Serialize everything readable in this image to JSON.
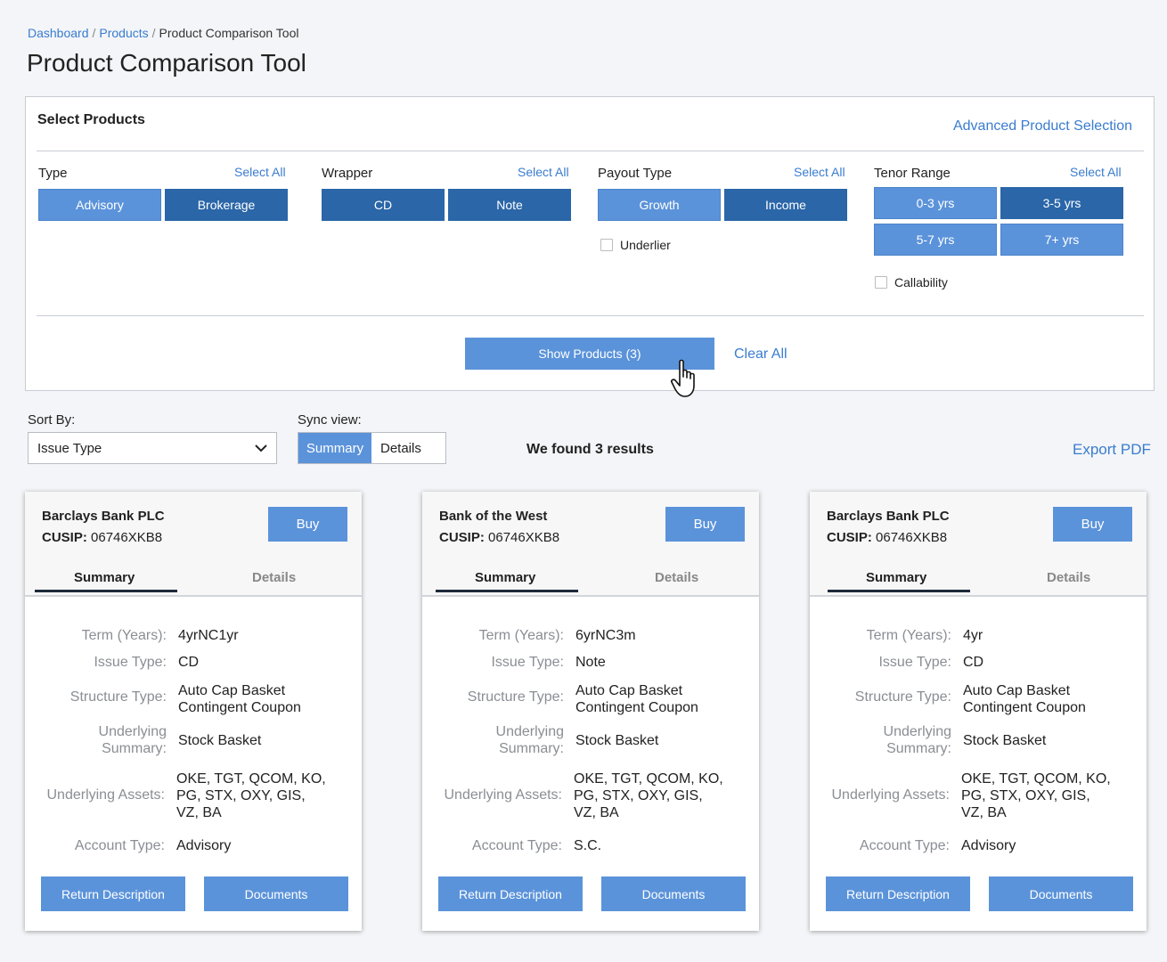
{
  "breadcrumb": {
    "items": [
      "Dashboard",
      "Products"
    ],
    "current": "Product Comparison Tool",
    "separator": "/"
  },
  "page_title": "Product Comparison Tool",
  "select_panel": {
    "title": "Select Products",
    "advanced_link": "Advanced Product Selection",
    "select_all_label": "Select All",
    "groups": {
      "type": {
        "label": "Type",
        "options": [
          "Advisory",
          "Brokerage"
        ]
      },
      "wrapper": {
        "label": "Wrapper",
        "options": [
          "CD",
          "Note"
        ]
      },
      "payout": {
        "label": "Payout Type",
        "options": [
          "Growth",
          "Income"
        ],
        "checkbox": "Underlier"
      },
      "tenor": {
        "label": "Tenor Range",
        "options": [
          "0-3 yrs",
          "3-5 yrs",
          "5-7 yrs",
          "7+ yrs"
        ],
        "checkbox": "Callability"
      }
    },
    "show_button": "Show Products (3)",
    "clear_all": "Clear All"
  },
  "controls": {
    "sort_label": "Sort By:",
    "sort_value": "Issue Type",
    "sync_label": "Sync view:",
    "sync_options": [
      "Summary",
      "Details"
    ],
    "results": "We found 3 results",
    "export": "Export PDF"
  },
  "field_labels": {
    "term": "Term (Years):",
    "issue_type": "Issue Type:",
    "structure_type": "Structure Type:",
    "underlying_summary_1": "Underlying",
    "underlying_summary_2": "Summary:",
    "underlying_assets": "Underlying Assets:",
    "account_type": "Account Type:"
  },
  "card_tabs": [
    "Summary",
    "Details"
  ],
  "card_buttons": {
    "buy": "Buy",
    "return_description": "Return Description",
    "documents": "Documents"
  },
  "cusip_label": "CUSIP:",
  "cards": [
    {
      "issuer": "Barclays Bank PLC",
      "cusip": "06746XKB8",
      "term": "4yrNC1yr",
      "issue_type": "CD",
      "structure_1": "Auto Cap Basket",
      "structure_2": "Contingent Coupon",
      "underlying_summary": "Stock Basket",
      "assets_1": "OKE, TGT, QCOM, KO,",
      "assets_2": "PG, STX, OXY, GIS,",
      "assets_3": "VZ, BA",
      "account_type": "Advisory"
    },
    {
      "issuer": "Bank of the West",
      "cusip": "06746XKB8",
      "term": "6yrNC3m",
      "issue_type": "Note",
      "structure_1": "Auto Cap Basket",
      "structure_2": "Contingent Coupon",
      "underlying_summary": "Stock Basket",
      "assets_1": "OKE, TGT, QCOM, KO,",
      "assets_2": "PG, STX, OXY, GIS,",
      "assets_3": "VZ, BA",
      "account_type": "S.C."
    },
    {
      "issuer": "Barclays Bank PLC",
      "cusip": "06746XKB8",
      "term": "4yr",
      "issue_type": "CD",
      "structure_1": "Auto Cap Basket",
      "structure_2": "Contingent Coupon",
      "underlying_summary": "Stock Basket",
      "assets_1": "OKE, TGT, QCOM, KO,",
      "assets_2": "PG, STX, OXY, GIS,",
      "assets_3": "VZ, BA",
      "account_type": "Advisory"
    }
  ]
}
